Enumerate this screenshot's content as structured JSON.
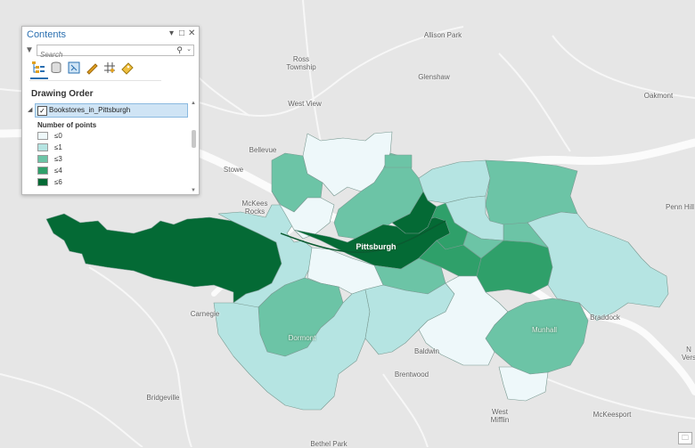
{
  "contents_pane": {
    "title": "Contents",
    "search_placeholder": "Search",
    "heading": "Drawing Order",
    "layer_name": "Bookstores_in_Pittsburgh",
    "field_name": "Number of points",
    "classes": [
      {
        "label": "≤0",
        "color": "#eef8fa"
      },
      {
        "label": "≤1",
        "color": "#b5e4e2"
      },
      {
        "label": "≤3",
        "color": "#6cc4a6"
      },
      {
        "label": "≤4",
        "color": "#2fa06a"
      },
      {
        "label": "≤6",
        "color": "#046a35"
      }
    ],
    "toolbar_icons": [
      "list-by-drawing-order-icon",
      "list-by-data-source-icon",
      "list-by-selection-icon",
      "list-by-editing-icon",
      "list-by-snapping-icon",
      "list-by-labeling-icon"
    ]
  },
  "map": {
    "basemap_color": "#e6e6e6",
    "places": {
      "allison_park": "Allison Park",
      "ross_township": "Ross\nTownship",
      "glenshaw": "Glenshaw",
      "oakmont": "Oakmont",
      "west_view": "West View",
      "bellevue": "Bellevue",
      "stowe": "Stowe",
      "mckees_rocks": "McKees\nRocks",
      "penn_hills": "Penn Hill",
      "pittsburgh": "Pittsburgh",
      "carnegie": "Carnegie",
      "dormont": "Dormont",
      "munhall": "Munhall",
      "braddock": "Braddock",
      "baldwin": "Baldwin",
      "brentwood": "Brentwood",
      "bridgeville": "Bridgeville",
      "west_mifflin": "West\nMifflin",
      "mckeesport": "McKeesport",
      "north_versailles": "N\nVers",
      "bethel_park": "Bethel Park"
    }
  }
}
